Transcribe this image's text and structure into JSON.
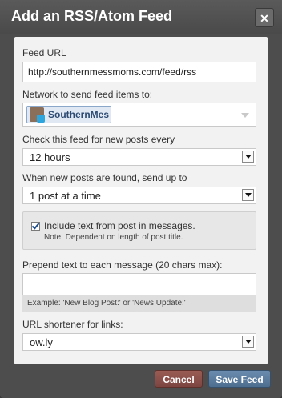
{
  "dialog": {
    "title": "Add an RSS/Atom Feed",
    "close_glyph": "✕"
  },
  "feed_url": {
    "label": "Feed URL",
    "value": "http://southernmessmoms.com/feed/rss"
  },
  "network": {
    "label": "Network to send feed items to:",
    "selected": "SouthernMes",
    "icon": "twitter-icon"
  },
  "frequency": {
    "label": "Check this feed for new posts every",
    "value": "12 hours"
  },
  "send_up_to": {
    "label": "When new posts are found, send up to",
    "value": "1 post at a time"
  },
  "include_text": {
    "checked": true,
    "label": "Include text from post in messages.",
    "note": "Note: Dependent on length of post title."
  },
  "prepend": {
    "label": "Prepend text to each message (20 chars max):",
    "value": "",
    "example": "Example: 'New Blog Post:' or 'News Update:'"
  },
  "shortener": {
    "label": "URL shortener for links:",
    "value": "ow.ly"
  },
  "buttons": {
    "cancel": "Cancel",
    "save": "Save Feed"
  },
  "colors": {
    "cancel_bg": "#8b4f49",
    "save_bg": "#5b7b9e",
    "chip_text": "#2d4a72"
  }
}
